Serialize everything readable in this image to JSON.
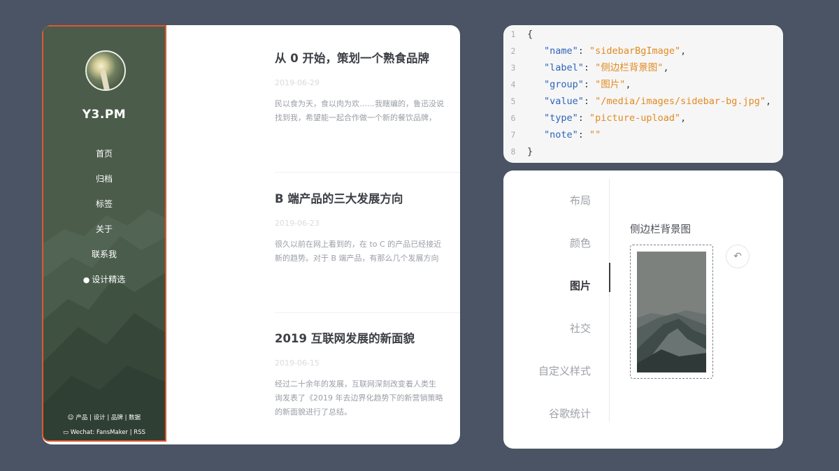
{
  "blog": {
    "site_title": "Y3.PM",
    "nav": [
      {
        "label": "首页"
      },
      {
        "label": "归档"
      },
      {
        "label": "标签"
      },
      {
        "label": "关于"
      },
      {
        "label": "联系我"
      },
      {
        "label": "设计精选",
        "icon": "apple-icon"
      }
    ],
    "footer": {
      "line1": "产品 | 设计 | 品牌 | 数据",
      "line2": "Wechat: FansMaker | RSS"
    },
    "posts": [
      {
        "title": "从 0 开始，策划一个熟食品牌",
        "date": "2019-06-29",
        "excerpt_line1": "民以食为天，食以肉为欢……我瞎编的，鲁迅没说",
        "excerpt_line2": "找到我，希望能一起合作做一个新的餐饮品牌，"
      },
      {
        "title": "B 端产品的三大发展方向",
        "date": "2019-06-23",
        "excerpt_line1": "很久以前在网上看到的，在 to C 的产品已经接近",
        "excerpt_line2": "新的趋势。对于 B 端产品，有那么几个发展方向"
      },
      {
        "title": "2019 互联网发展的新面貌",
        "date": "2019-06-15",
        "excerpt_line1": "经过二十余年的发展，互联网深刻改变着人类生",
        "excerpt_line2": "询发表了《2019 年去边界化趋势下的新营销策略",
        "excerpt_line3": "的新面貌进行了总结。"
      }
    ]
  },
  "code": {
    "lines": [
      {
        "n": "1",
        "key": "",
        "value": "",
        "text": "{"
      },
      {
        "n": "2",
        "key": "\"name\"",
        "value": "\"sidebarBgImage\""
      },
      {
        "n": "3",
        "key": "\"label\"",
        "value": "\"侧边栏背景图\""
      },
      {
        "n": "4",
        "key": "\"group\"",
        "value": "\"图片\""
      },
      {
        "n": "5",
        "key": "\"value\"",
        "value": "\"/media/images/sidebar-bg.jpg\""
      },
      {
        "n": "6",
        "key": "\"type\"",
        "value": "\"picture-upload\""
      },
      {
        "n": "7",
        "key": "\"note\"",
        "value": "\"\""
      },
      {
        "n": "8",
        "key": "",
        "value": "",
        "text": "}"
      }
    ]
  },
  "settings": {
    "tabs": [
      {
        "label": "布局"
      },
      {
        "label": "颜色"
      },
      {
        "label": "图片",
        "active": true
      },
      {
        "label": "社交"
      },
      {
        "label": "自定义样式"
      },
      {
        "label": "谷歌统计"
      }
    ],
    "field_label": "侧边栏背景图",
    "reset_icon": "undo-icon"
  },
  "colors": {
    "background": "#4a5464",
    "sidebar_outline": "#e0582c",
    "code_key": "#2f64b8",
    "code_string": "#e28a1f"
  }
}
